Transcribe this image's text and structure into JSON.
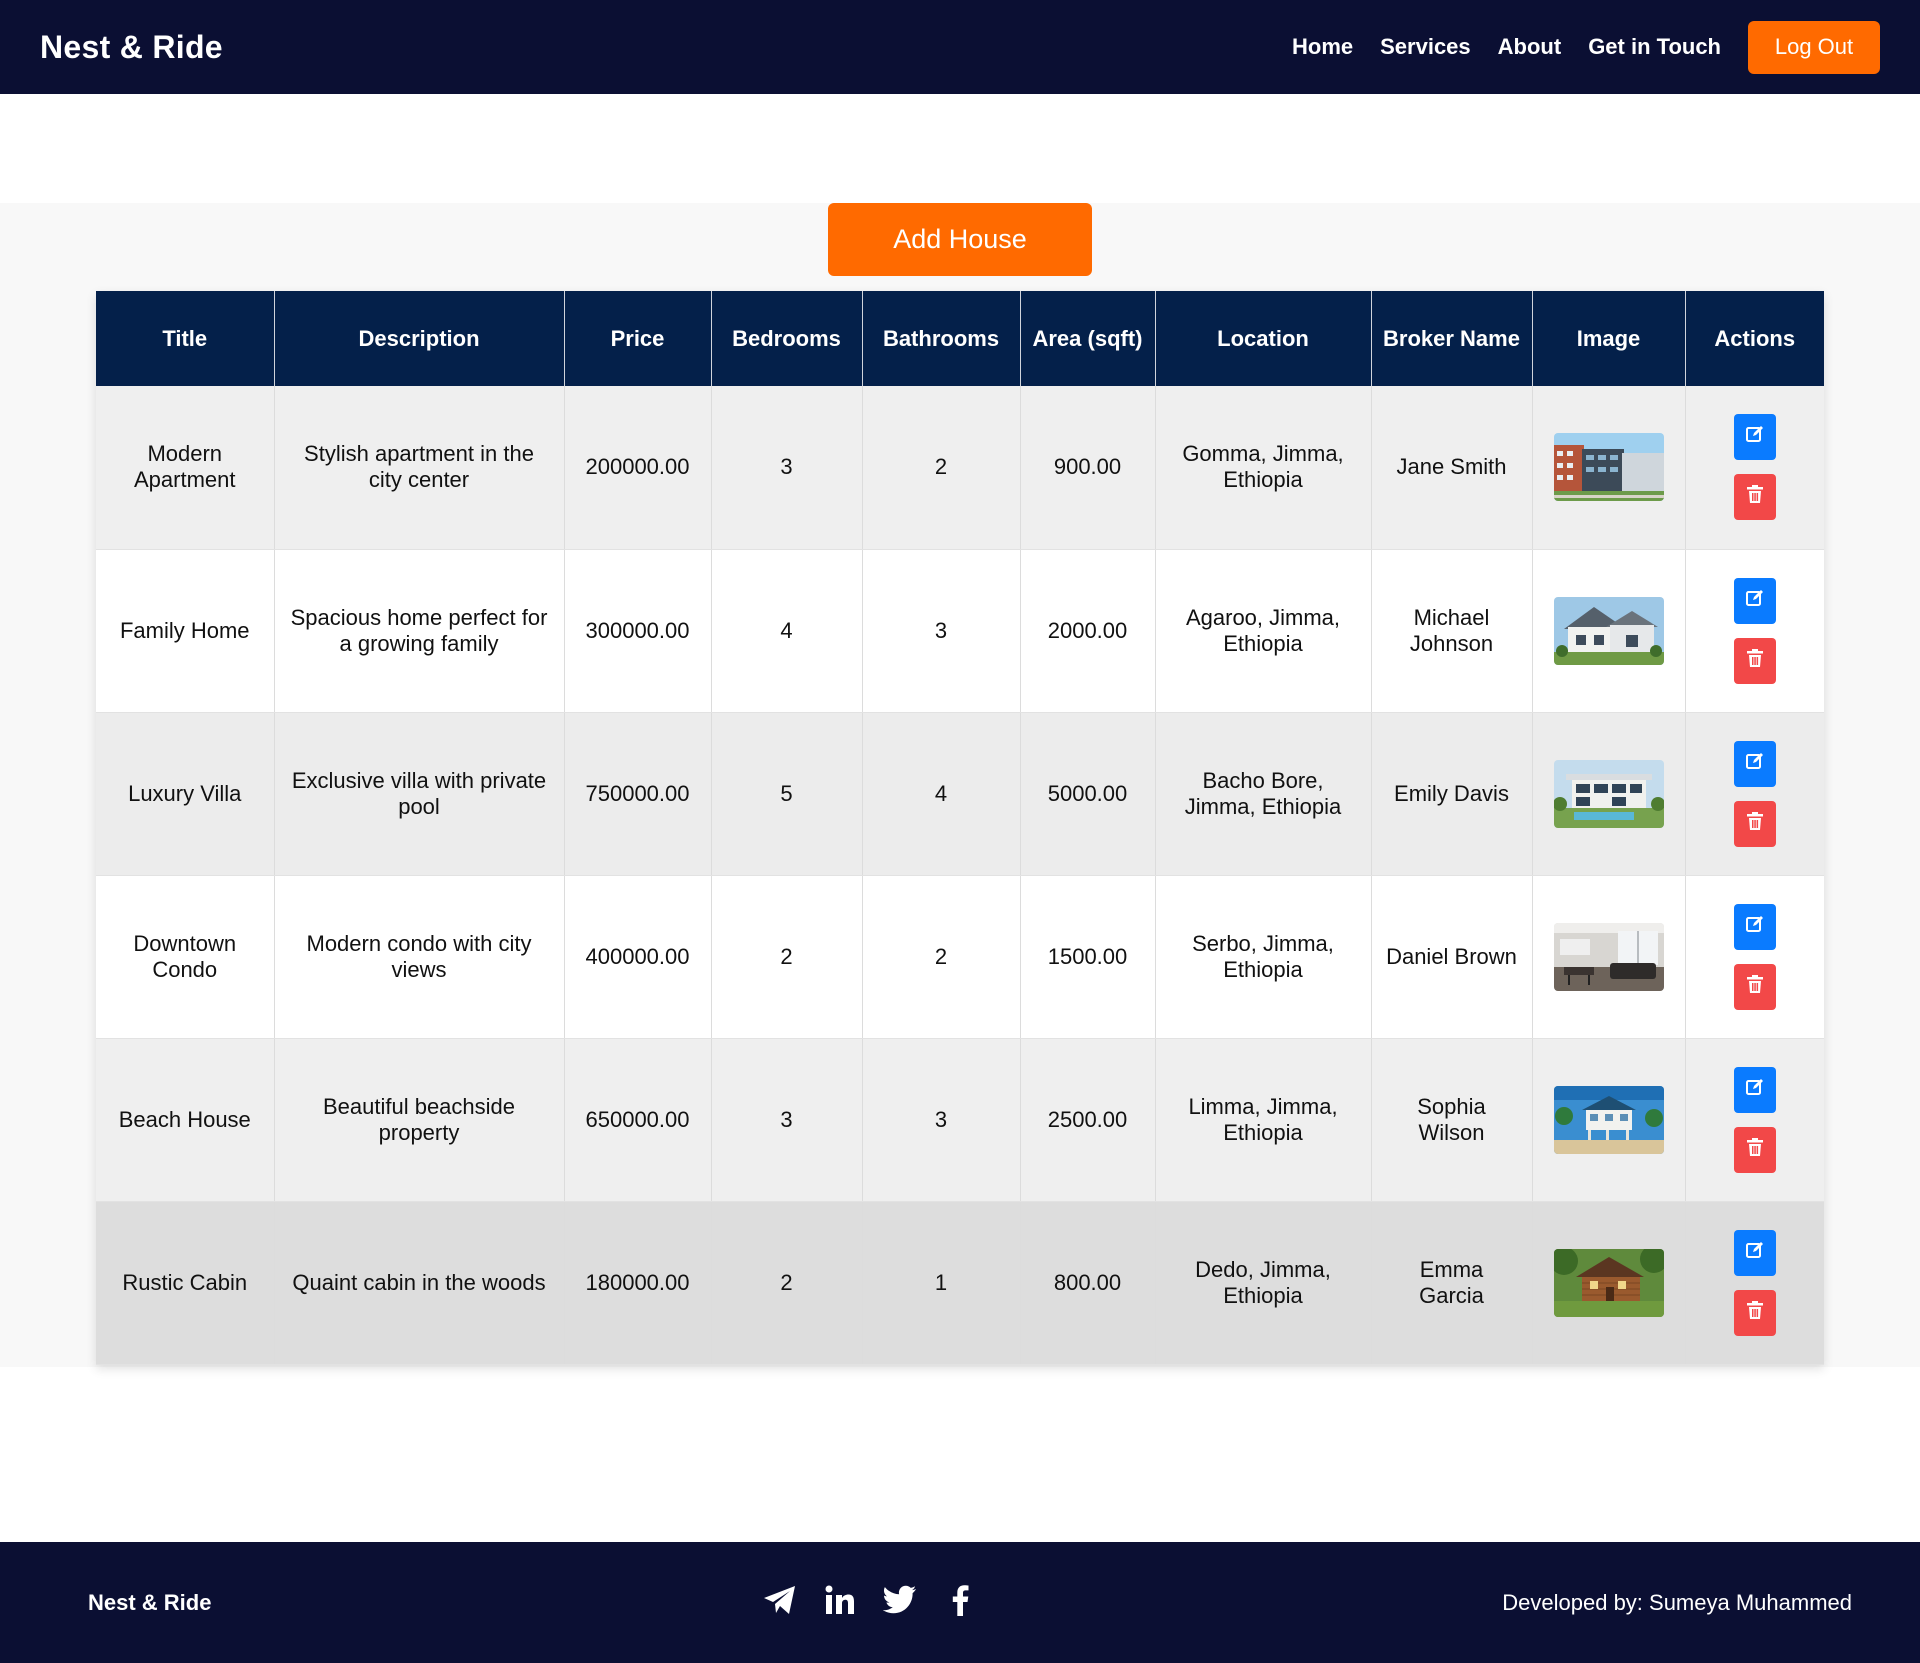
{
  "header": {
    "brand": "Nest & Ride",
    "nav": [
      "Home",
      "Services",
      "About",
      "Get in Touch"
    ],
    "logout_label": "Log Out"
  },
  "main": {
    "add_button_label": "Add House",
    "columns": [
      "Title",
      "Description",
      "Price",
      "Bedrooms",
      "Bathrooms",
      "Area (sqft)",
      "Location",
      "Broker Name",
      "Image",
      "Actions"
    ],
    "rows": [
      {
        "title": "Modern Apartment",
        "description": "Stylish apartment in the city center",
        "price": "200000.00",
        "bedrooms": "3",
        "bathrooms": "2",
        "area": "900.00",
        "location": "Gomma, Jimma, Ethiopia",
        "broker": "Jane Smith",
        "image": "apartment-building-photo"
      },
      {
        "title": "Family Home",
        "description": "Spacious home perfect for a growing family",
        "price": "300000.00",
        "bedrooms": "4",
        "bathrooms": "3",
        "area": "2000.00",
        "location": "Agaroo, Jimma, Ethiopia",
        "broker": "Michael Johnson",
        "image": "family-home-photo"
      },
      {
        "title": "Luxury Villa",
        "description": "Exclusive villa with private pool",
        "price": "750000.00",
        "bedrooms": "5",
        "bathrooms": "4",
        "area": "5000.00",
        "location": "Bacho Bore, Jimma, Ethiopia",
        "broker": "Emily Davis",
        "image": "luxury-villa-photo"
      },
      {
        "title": "Downtown Condo",
        "description": "Modern condo with city views",
        "price": "400000.00",
        "bedrooms": "2",
        "bathrooms": "2",
        "area": "1500.00",
        "location": "Serbo, Jimma, Ethiopia",
        "broker": "Daniel Brown",
        "image": "condo-interior-photo"
      },
      {
        "title": "Beach House",
        "description": "Beautiful beachside property",
        "price": "650000.00",
        "bedrooms": "3",
        "bathrooms": "3",
        "area": "2500.00",
        "location": "Limma, Jimma, Ethiopia",
        "broker": "Sophia Wilson",
        "image": "beach-house-photo"
      },
      {
        "title": "Rustic Cabin",
        "description": "Quaint cabin in the woods",
        "price": "180000.00",
        "bedrooms": "2",
        "bathrooms": "1",
        "area": "800.00",
        "location": "Dedo, Jimma, Ethiopia",
        "broker": "Emma Garcia",
        "image": "wood-cabin-photo"
      }
    ]
  },
  "footer": {
    "brand": "Nest & Ride",
    "socials": [
      "telegram-icon",
      "linkedin-icon",
      "twitter-icon",
      "facebook-icon"
    ],
    "credit": "Developed by: Sumeya Muhammed"
  },
  "colors": {
    "navy": "#0b0f33",
    "table_header": "#04204a",
    "accent_orange": "#ff6a00",
    "edit_blue": "#0a7bff",
    "delete_red": "#f24848"
  }
}
